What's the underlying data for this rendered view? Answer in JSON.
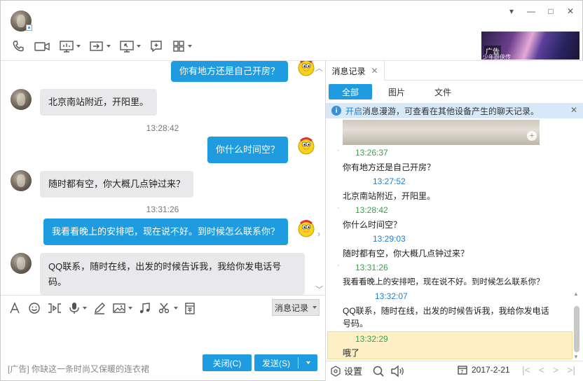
{
  "window": {
    "contact_name": "",
    "controls": {
      "menu": "▾",
      "minimize": "—",
      "maximize": "□",
      "close": "✕"
    },
    "ad_banner": {
      "tag": "广告",
      "subtitle": "少年群侠传"
    }
  },
  "toolbar": {
    "icons": [
      "phone-icon",
      "video-icon",
      "screen-share-icon",
      "transfer-file-icon",
      "remote-desktop-icon",
      "add-message-icon",
      "app-grid-icon"
    ]
  },
  "chat": {
    "messages": [
      {
        "side": "out",
        "text": "你有地方还是自己开房？"
      },
      {
        "side": "in",
        "text": "北京南站附近，开阳里。"
      },
      {
        "type": "time",
        "text": "13:28:42"
      },
      {
        "side": "out",
        "text": "你什么时间空？"
      },
      {
        "side": "in",
        "text": "随时都有空，你大概几点钟过来？"
      },
      {
        "type": "time",
        "text": "13:31:26"
      },
      {
        "side": "out",
        "text": "我看看晚上的安排吧，现在说不好。到时候怎么联系你？"
      },
      {
        "side": "in",
        "text": "QQ联系，随时在线，出发的时候告诉我，我给你发电话号码。"
      }
    ]
  },
  "input_area": {
    "history_button": "消息记录",
    "bottom_ad": "[广告] 你缺这一条时尚又保暖的连衣裙",
    "close_button": "关闭(C)",
    "send_button": "发送(S)"
  },
  "history": {
    "tab_label": "消息记录",
    "tab_close": "✕",
    "filters": [
      "全部",
      "图片",
      "文件"
    ],
    "notice": {
      "link": "开启",
      "text": "消息漫游，可查看在其他设备产生的聊天记录。",
      "close": "✕"
    },
    "entries": [
      {
        "time": "13:26:37",
        "color": "green",
        "text": "你有地方还是自己开房？"
      },
      {
        "time": "13:27:52",
        "color": "blue",
        "text": "北京南站附近，开阳里。"
      },
      {
        "time": "13:28:42",
        "color": "green",
        "text": "你什么时间空？"
      },
      {
        "time": "13:29:03",
        "color": "blue",
        "text": "随时都有空，你大概几点钟过来？"
      },
      {
        "time": "13:31:26",
        "color": "green",
        "text": "我看看晚上的安排吧，现在说不好。到时候怎么联系你？"
      },
      {
        "time": "13:32:07",
        "color": "blue",
        "text": "QQ联系，随时在线，出发的时候告诉我，我给你发电话号码。"
      },
      {
        "time": "13:32:29",
        "color": "green",
        "text": "哦了"
      }
    ],
    "bottom": {
      "settings": "设置",
      "date": "2017-2-21"
    }
  }
}
